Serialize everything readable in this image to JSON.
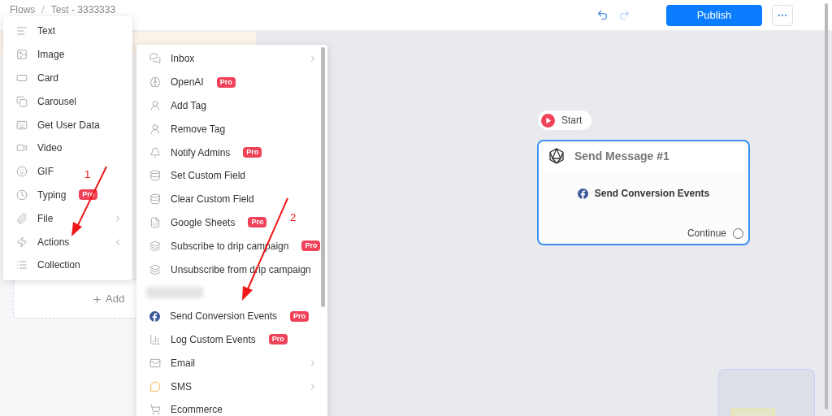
{
  "breadcrumb": [
    {
      "kind": "link",
      "label": "Flows"
    },
    {
      "kind": "separator",
      "label": "/"
    },
    {
      "kind": "link",
      "label": "Test - 3333333"
    }
  ],
  "toolbar": {
    "publish": "Publish"
  },
  "panel": {
    "add_label": "Add"
  },
  "block_menu": [
    {
      "label": "Text",
      "submenu": false
    },
    {
      "label": "Image",
      "submenu": false
    },
    {
      "label": "Card",
      "submenu": false
    },
    {
      "label": "Carousel",
      "submenu": false
    },
    {
      "label": "Get User Data",
      "submenu": false
    },
    {
      "label": "Video",
      "submenu": false
    },
    {
      "label": "GIF",
      "submenu": false
    },
    {
      "label": "Typing",
      "badge": "Pro",
      "submenu": false
    },
    {
      "label": "File",
      "submenu": true,
      "expanded": false
    },
    {
      "label": "Actions",
      "submenu": true,
      "expanded": true
    },
    {
      "label": "Collection",
      "submenu": false
    }
  ],
  "action_menu": [
    {
      "kind": "item",
      "label": "Inbox",
      "submenu": true,
      "expanded": false
    },
    {
      "kind": "item",
      "label": "OpenAI",
      "badge": "Pro",
      "submenu": false
    },
    {
      "kind": "item",
      "label": "Add Tag",
      "submenu": false
    },
    {
      "kind": "item",
      "label": "Remove Tag",
      "submenu": false
    },
    {
      "kind": "item",
      "label": "Notify Admins",
      "badge": "Pro",
      "submenu": false
    },
    {
      "kind": "item",
      "label": "Set Custom Field",
      "submenu": false
    },
    {
      "kind": "item",
      "label": "Clear Custom Field",
      "submenu": false
    },
    {
      "kind": "item",
      "label": "Google Sheets",
      "badge": "Pro",
      "submenu": false
    },
    {
      "kind": "item",
      "label": "Subscribe to drip campaign",
      "badge": "Pro",
      "submenu": false
    },
    {
      "kind": "item",
      "label": "Unsubscribe from drip campaign",
      "submenu": false
    },
    {
      "kind": "blurred"
    },
    {
      "kind": "item",
      "label": "Send Conversion Events",
      "badge": "Pro",
      "submenu": false
    },
    {
      "kind": "item",
      "label": "Log Custom Events",
      "badge": "Pro",
      "submenu": false
    },
    {
      "kind": "item",
      "label": "Email",
      "submenu": true,
      "expanded": false
    },
    {
      "kind": "item",
      "label": "SMS",
      "submenu": true,
      "expanded": false
    },
    {
      "kind": "item",
      "label": "Ecommerce",
      "submenu": false
    }
  ],
  "node": {
    "start": "Start",
    "title": "Send Message #1",
    "action": "Send Conversion Events",
    "output": "Continue"
  },
  "annotations": [
    {
      "label": "1"
    },
    {
      "label": "2"
    }
  ]
}
